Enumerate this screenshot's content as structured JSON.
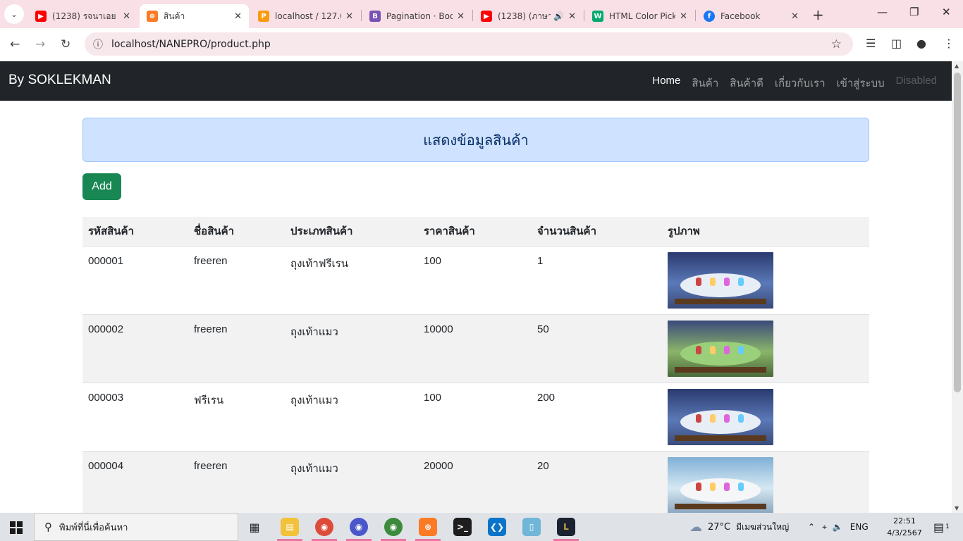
{
  "browser": {
    "tabs": [
      {
        "title": "(1238) รจนาเอย -",
        "icon": "youtube-icon",
        "color": "#ff0000"
      },
      {
        "title": "สินค้า",
        "icon": "xampp-icon",
        "color": "#fb7a24",
        "active": true
      },
      {
        "title": "localhost / 127.0",
        "icon": "phpmyadmin-icon",
        "color": "#f89c0e"
      },
      {
        "title": "Pagination · Boo",
        "icon": "bootstrap-icon",
        "color": "#7952b3"
      },
      {
        "title": "(1238) (ภาษา",
        "icon": "youtube-icon",
        "color": "#ff0000"
      },
      {
        "title": "HTML Color Pick",
        "icon": "w3schools-icon",
        "color": "#04aa6d"
      },
      {
        "title": "Facebook",
        "icon": "facebook-icon",
        "color": "#1877f2"
      }
    ],
    "url": "localhost/NANEPRO/product.php"
  },
  "navbar": {
    "brand": "By SOKLEKMAN",
    "links": [
      "Home",
      "สินค้า",
      "สินค้าดี",
      "เกี่ยวกับเรา",
      "เข้าสู่ระบบ",
      "Disabled"
    ]
  },
  "page": {
    "heading": "แสดงข้อมูลสินค้า",
    "add_button": "Add"
  },
  "table": {
    "headers": [
      "รหัสสินค้า",
      "ชื่อสินค้า",
      "ประเภทสินค้า",
      "ราคาสินค้า",
      "จำนวนสินค้า",
      "รูปภาพ"
    ],
    "rows": [
      {
        "id": "000001",
        "name": "freeren",
        "type": "ถุงเท้าฟรีเรน",
        "price": "100",
        "qty": "1"
      },
      {
        "id": "000002",
        "name": "freeren",
        "type": "ถุงเท้าแมว",
        "price": "10000",
        "qty": "50"
      },
      {
        "id": "000003",
        "name": "ฟรีเรน",
        "type": "ถุงเท้าแมว",
        "price": "100",
        "qty": "200"
      },
      {
        "id": "000004",
        "name": "freeren",
        "type": "ถุงเท้าแมว",
        "price": "20000",
        "qty": "20"
      }
    ]
  },
  "taskbar": {
    "search_placeholder": "พิมพ์ที่นี่เพื่อค้นหา",
    "weather_temp": "27°C",
    "weather_text": "มีเมฆส่วนใหญ่",
    "language": "ENG",
    "time": "22:51",
    "date": "4/3/2567",
    "notification_count": "1"
  },
  "colors": {
    "navbar_bg": "#212529",
    "alert_bg": "#cfe2ff",
    "add_button_bg": "#198754",
    "tabstrip_bg": "#f9dfe6"
  }
}
